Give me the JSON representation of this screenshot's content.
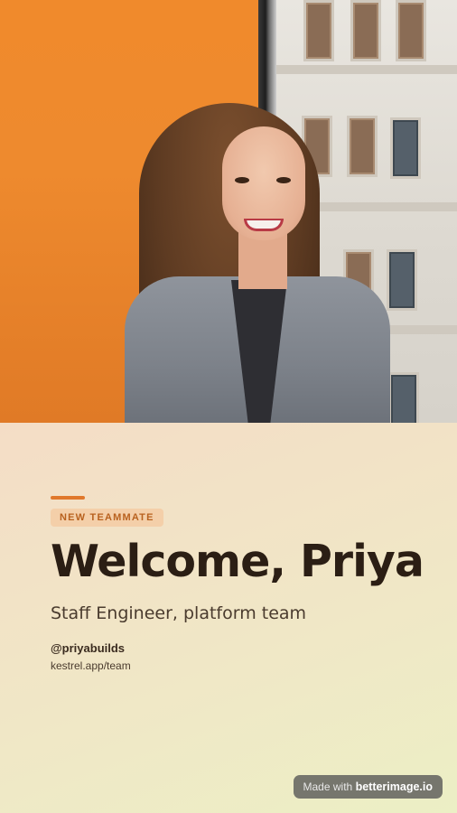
{
  "card": {
    "tag": "NEW TEAMMATE",
    "title": "Welcome, Priya",
    "subtitle": "Staff Engineer, platform team",
    "handle": "@priyabuilds",
    "link": "kestrel.app/team"
  },
  "badge": {
    "prefix": "Made with",
    "brand": "betterimage.io"
  },
  "colors": {
    "accent": "#e0782c",
    "tag_background": "#f4cfa9",
    "tag_text": "#b8611e",
    "title_text": "#2b1e14",
    "orange_wall": "#f08a2c"
  }
}
